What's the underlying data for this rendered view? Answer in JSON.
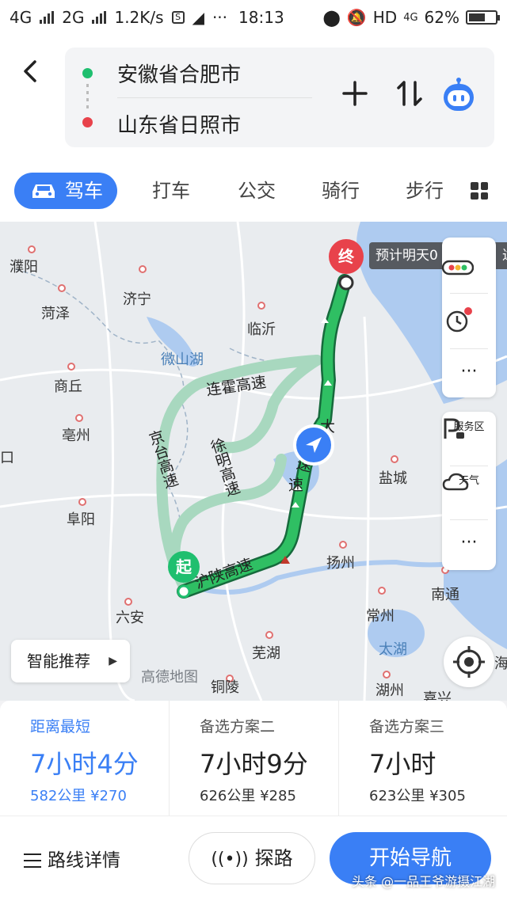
{
  "status_bar": {
    "network_1": "4G",
    "network_2": "2G",
    "speed": "1.2K/s",
    "dots": "···",
    "time": "18:13",
    "hd": "HD",
    "net_badge": "4G",
    "battery": "62%",
    "battery_level": 0.62
  },
  "header": {
    "from": "安徽省合肥市",
    "to": "山东省日照市"
  },
  "modes": [
    "驾车",
    "打车",
    "公交",
    "骑行",
    "步行"
  ],
  "map": {
    "end_pin": "终",
    "start_pin": "起",
    "eta_text": "预计明天0",
    "eta_edge": "达",
    "cities": [
      "濮阳",
      "菏泽",
      "济宁",
      "临沂",
      "商丘",
      "亳州",
      "阜阳",
      "六安",
      "盐城",
      "扬州",
      "南通",
      "常州",
      "芜湖",
      "湖州",
      "铜陵",
      "嘉兴",
      "口",
      "海"
    ],
    "lakes": [
      "微山湖",
      "太湖"
    ],
    "highways": {
      "lianhuo": "连霍高速",
      "jingtai": "京台高速",
      "xuming": "徐明高速",
      "hushan": "沪陕高速",
      "route_v1": "高速",
      "route_v2": "速",
      "route_v3": "大"
    },
    "side_tools": {
      "service_area": "服务区",
      "weather": "天气",
      "more": "···"
    },
    "smart_recommend": "智能推荐",
    "logo": "高德地图"
  },
  "plans": [
    {
      "tag": "距离最短",
      "time": "7小时4分",
      "distance": "582公里",
      "fee": "¥270"
    },
    {
      "tag": "备选方案二",
      "time": "7小时9分",
      "distance": "626公里",
      "fee": "¥285"
    },
    {
      "tag": "备选方案三",
      "time": "7小时",
      "distance": "623公里",
      "fee": "¥305"
    }
  ],
  "bottom": {
    "details": "路线详情",
    "explore": "探路",
    "start": "开始导航"
  },
  "watermark": "头条 @一品王爷游摄江湖",
  "colors": {
    "accent": "#3a7ff5",
    "route": "#26b05a",
    "start": "#1fbf6f",
    "end": "#e8424b"
  }
}
